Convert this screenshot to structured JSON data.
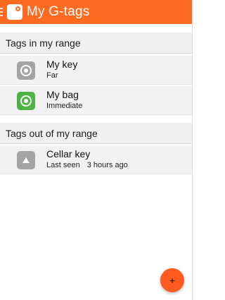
{
  "app": {
    "title": "My G-tags",
    "accent_color": "#ff6a21",
    "menu_icon": "drawer-menu-icon",
    "logo_icon": "app-logo-icon"
  },
  "sections": {
    "in_range": {
      "title": "Tags in my range",
      "items": [
        {
          "name": "My key",
          "status": "Far",
          "icon": "signal-far-icon",
          "icon_color": "#a4a4a4"
        },
        {
          "name": "My bag",
          "status": "Immediate",
          "icon": "signal-immediate-icon",
          "icon_color": "#4db344"
        }
      ]
    },
    "out_of_range": {
      "title": "Tags out of my range",
      "items": [
        {
          "name": "Cellar key",
          "status_label": "Last seen",
          "status_value": "3 hours ago",
          "icon": "out-of-range-icon",
          "icon_color": "#a4a4a4"
        }
      ]
    }
  },
  "fab": {
    "label": "+",
    "icon": "add-icon",
    "color": "#ff5a1f"
  }
}
